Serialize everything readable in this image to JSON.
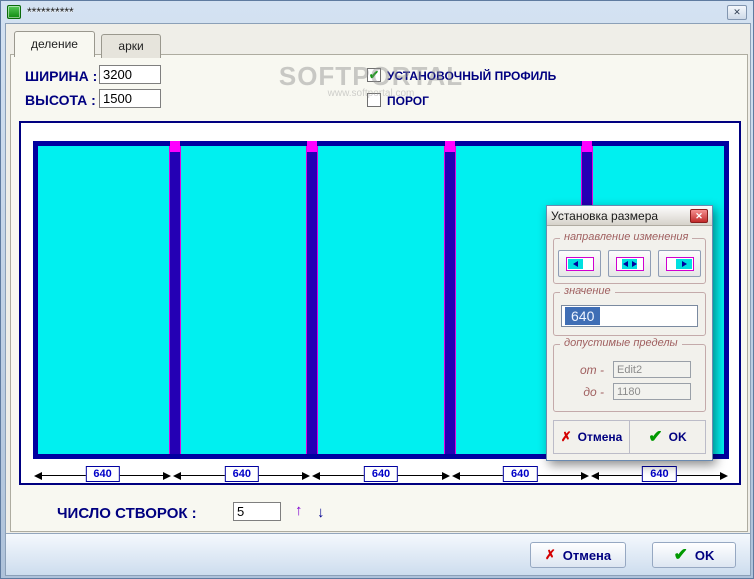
{
  "window": {
    "title": "**********",
    "close_glyph": "✕"
  },
  "tabs": [
    {
      "label": "деление"
    },
    {
      "label": "арки"
    }
  ],
  "form": {
    "width_label": "ШИРИНА :",
    "width_value": "3200",
    "height_label": "ВЫСОТА :",
    "height_value": "1500",
    "profile_label": "УСТАНОВОЧНЫЙ ПРОФИЛЬ",
    "profile_check_glyph": "✔",
    "porog_label": "ПОРОГ"
  },
  "watermark": {
    "title": "SOFTPORTAL",
    "url": "www.softportal.com"
  },
  "drawing": {
    "panel_count": 5,
    "dimension_labels": [
      "640",
      "640",
      "640",
      "640",
      "640"
    ]
  },
  "sashes": {
    "label": "ЧИСЛО СТВОРОК :",
    "value": "5",
    "up_glyph": "↑",
    "down_glyph": "↓"
  },
  "footer": {
    "cancel_label": "Отмена",
    "cancel_glyph": "✗",
    "ok_label": "OK",
    "ok_glyph": "✔"
  },
  "size_dialog": {
    "title": "Установка размера",
    "close_glyph": "✕",
    "direction_group": "направление изменения",
    "value_group": "значение",
    "value": "640",
    "limits_group": "допустимые пределы",
    "from_label": "от -",
    "from_value": "Edit2",
    "to_label": "до -",
    "to_value": "1180",
    "cancel_label": "Отмена",
    "cancel_glyph": "✗",
    "ok_label": "OK",
    "ok_glyph": "✔"
  },
  "colors": {
    "navy": "#000080",
    "cyan": "#00F0F0",
    "divider_blue": "#2400B4",
    "magenta": "#FF00FF",
    "ok_green": "#009900",
    "cancel_red": "#D40000"
  }
}
